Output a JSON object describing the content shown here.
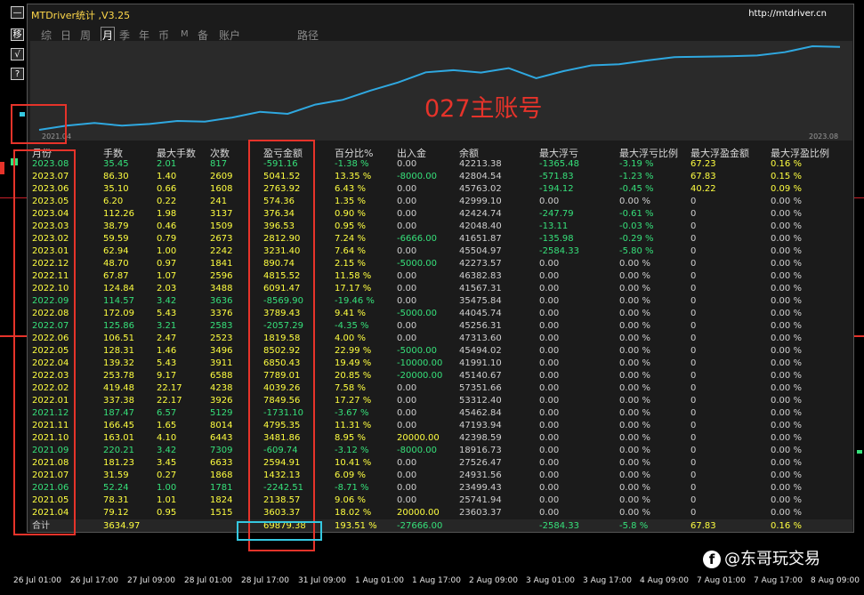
{
  "window": {
    "title": "MTDriver统计 ,V3.25",
    "url": "http://mtdriver.cn"
  },
  "side_buttons": [
    "—",
    "移",
    "√",
    "?"
  ],
  "tabs": [
    "综",
    "日",
    "周",
    "月",
    "季",
    "年",
    "币",
    "M",
    "备",
    "账户",
    "路径"
  ],
  "active_tab": "月",
  "overlay_label": "027主账号",
  "equity_chart": {
    "start_label": "2021.04",
    "end_label": "2023.08",
    "line_color": "#2fa8e0",
    "balance_values": [
      23603.37,
      25741.94,
      23499.43,
      24931.56,
      27526.47,
      18916.73,
      42398.59,
      47193.94,
      45462.84,
      53312.4,
      57351.66,
      45140.67,
      41991.1,
      45494.02,
      47313.6,
      45256.31,
      44045.74,
      35475.84,
      41567.31,
      46382.83,
      42273.57,
      45504.97,
      41651.87,
      42048.4,
      42424.74,
      42999.1,
      45763.02,
      42804.54,
      42213.38
    ]
  },
  "table": {
    "headers": [
      "月份",
      "手数",
      "最大手数",
      "次数",
      "盈亏金额",
      "百分比%",
      "出入金",
      "余额",
      "最大浮亏",
      "最大浮亏比例",
      "最大浮盈金额",
      "最大浮盈比例"
    ],
    "rows": [
      [
        "2023.08",
        "35.45",
        "2.01",
        "817",
        "-591.16",
        "-1.38 %",
        "0.00",
        "42213.38",
        "-1365.48",
        "-3.19 %",
        "67.23",
        "0.16 %"
      ],
      [
        "2023.07",
        "86.30",
        "1.40",
        "2609",
        "5041.52",
        "13.35 %",
        "-8000.00",
        "42804.54",
        "-571.83",
        "-1.23 %",
        "67.83",
        "0.15 %"
      ],
      [
        "2023.06",
        "35.10",
        "0.66",
        "1608",
        "2763.92",
        "6.43 %",
        "0.00",
        "45763.02",
        "-194.12",
        "-0.45 %",
        "40.22",
        "0.09 %"
      ],
      [
        "2023.05",
        "6.20",
        "0.22",
        "241",
        "574.36",
        "1.35 %",
        "0.00",
        "42999.10",
        "0.00",
        "0.00 %",
        "0",
        "0.00 %"
      ],
      [
        "2023.04",
        "112.26",
        "1.98",
        "3137",
        "376.34",
        "0.90 %",
        "0.00",
        "42424.74",
        "-247.79",
        "-0.61 %",
        "0",
        "0.00 %"
      ],
      [
        "2023.03",
        "38.79",
        "0.46",
        "1509",
        "396.53",
        "0.95 %",
        "0.00",
        "42048.40",
        "-13.11",
        "-0.03 %",
        "0",
        "0.00 %"
      ],
      [
        "2023.02",
        "59.59",
        "0.79",
        "2673",
        "2812.90",
        "7.24 %",
        "-6666.00",
        "41651.87",
        "-135.98",
        "-0.29 %",
        "0",
        "0.00 %"
      ],
      [
        "2023.01",
        "62.94",
        "1.00",
        "2242",
        "3231.40",
        "7.64 %",
        "0.00",
        "45504.97",
        "-2584.33",
        "-5.80 %",
        "0",
        "0.00 %"
      ],
      [
        "2022.12",
        "48.70",
        "0.97",
        "1841",
        "890.74",
        "2.15 %",
        "-5000.00",
        "42273.57",
        "0.00",
        "0.00 %",
        "0",
        "0.00 %"
      ],
      [
        "2022.11",
        "67.87",
        "1.07",
        "2596",
        "4815.52",
        "11.58 %",
        "0.00",
        "46382.83",
        "0.00",
        "0.00 %",
        "0",
        "0.00 %"
      ],
      [
        "2022.10",
        "124.84",
        "2.03",
        "3488",
        "6091.47",
        "17.17 %",
        "0.00",
        "41567.31",
        "0.00",
        "0.00 %",
        "0",
        "0.00 %"
      ],
      [
        "2022.09",
        "114.57",
        "3.42",
        "3636",
        "-8569.90",
        "-19.46 %",
        "0.00",
        "35475.84",
        "0.00",
        "0.00 %",
        "0",
        "0.00 %"
      ],
      [
        "2022.08",
        "172.09",
        "5.43",
        "3376",
        "3789.43",
        "9.41 %",
        "-5000.00",
        "44045.74",
        "0.00",
        "0.00 %",
        "0",
        "0.00 %"
      ],
      [
        "2022.07",
        "125.86",
        "3.21",
        "2583",
        "-2057.29",
        "-4.35 %",
        "0.00",
        "45256.31",
        "0.00",
        "0.00 %",
        "0",
        "0.00 %"
      ],
      [
        "2022.06",
        "106.51",
        "2.47",
        "2523",
        "1819.58",
        "4.00 %",
        "0.00",
        "47313.60",
        "0.00",
        "0.00 %",
        "0",
        "0.00 %"
      ],
      [
        "2022.05",
        "128.31",
        "1.46",
        "3496",
        "8502.92",
        "22.99 %",
        "-5000.00",
        "45494.02",
        "0.00",
        "0.00 %",
        "0",
        "0.00 %"
      ],
      [
        "2022.04",
        "139.32",
        "5.43",
        "3911",
        "6850.43",
        "19.49 %",
        "-10000.00",
        "41991.10",
        "0.00",
        "0.00 %",
        "0",
        "0.00 %"
      ],
      [
        "2022.03",
        "253.78",
        "9.17",
        "6588",
        "7789.01",
        "20.85 %",
        "-20000.00",
        "45140.67",
        "0.00",
        "0.00 %",
        "0",
        "0.00 %"
      ],
      [
        "2022.02",
        "419.48",
        "22.17",
        "4238",
        "4039.26",
        "7.58 %",
        "0.00",
        "57351.66",
        "0.00",
        "0.00 %",
        "0",
        "0.00 %"
      ],
      [
        "2022.01",
        "337.38",
        "22.17",
        "3926",
        "7849.56",
        "17.27 %",
        "0.00",
        "53312.40",
        "0.00",
        "0.00 %",
        "0",
        "0.00 %"
      ],
      [
        "2021.12",
        "187.47",
        "6.57",
        "5129",
        "-1731.10",
        "-3.67 %",
        "0.00",
        "45462.84",
        "0.00",
        "0.00 %",
        "0",
        "0.00 %"
      ],
      [
        "2021.11",
        "166.45",
        "1.65",
        "8014",
        "4795.35",
        "11.31 %",
        "0.00",
        "47193.94",
        "0.00",
        "0.00 %",
        "0",
        "0.00 %"
      ],
      [
        "2021.10",
        "163.01",
        "4.10",
        "6443",
        "3481.86",
        "8.95 %",
        "20000.00",
        "42398.59",
        "0.00",
        "0.00 %",
        "0",
        "0.00 %"
      ],
      [
        "2021.09",
        "220.21",
        "3.42",
        "7309",
        "-609.74",
        "-3.12 %",
        "-8000.00",
        "18916.73",
        "0.00",
        "0.00 %",
        "0",
        "0.00 %"
      ],
      [
        "2021.08",
        "181.23",
        "3.45",
        "6633",
        "2594.91",
        "10.41 %",
        "0.00",
        "27526.47",
        "0.00",
        "0.00 %",
        "0",
        "0.00 %"
      ],
      [
        "2021.07",
        "31.59",
        "0.27",
        "1868",
        "1432.13",
        "6.09 %",
        "0.00",
        "24931.56",
        "0.00",
        "0.00 %",
        "0",
        "0.00 %"
      ],
      [
        "2021.06",
        "52.24",
        "1.00",
        "1781",
        "-2242.51",
        "-8.71 %",
        "0.00",
        "23499.43",
        "0.00",
        "0.00 %",
        "0",
        "0.00 %"
      ],
      [
        "2021.05",
        "78.31",
        "1.01",
        "1824",
        "2138.57",
        "9.06 %",
        "0.00",
        "25741.94",
        "0.00",
        "0.00 %",
        "0",
        "0.00 %"
      ],
      [
        "2021.04",
        "79.12",
        "0.95",
        "1515",
        "3603.37",
        "18.02 %",
        "20000.00",
        "23603.37",
        "0.00",
        "0.00 %",
        "0",
        "0.00 %"
      ]
    ],
    "total": [
      "合计",
      "3634.97",
      "",
      "",
      "69879.38",
      "193.51 %",
      "-27666.00",
      "",
      "-2584.33",
      "-5.8 %",
      "67.83",
      "0.16 %"
    ]
  },
  "bottom_axis": [
    "26 Jul 01:00",
    "26 Jul 17:00",
    "27 Jul 09:00",
    "28 Jul 01:00",
    "28 Jul 17:00",
    "31 Jul 09:00",
    "1 Aug 01:00",
    "1 Aug 17:00",
    "2 Aug 09:00",
    "3 Aug 01:00",
    "3 Aug 17:00",
    "4 Aug 09:00",
    "7 Aug 01:00",
    "7 Aug 17:00",
    "8 Aug 09:00"
  ],
  "watermark": {
    "icon": "facebook-icon",
    "text": "@东哥玩交易"
  },
  "colors": {
    "positive": "#ffff40",
    "negative": "#36e07a",
    "neutral": "#cfcfcf",
    "annotation_red": "#e6332a",
    "annotation_cyan": "#35c8e0"
  }
}
